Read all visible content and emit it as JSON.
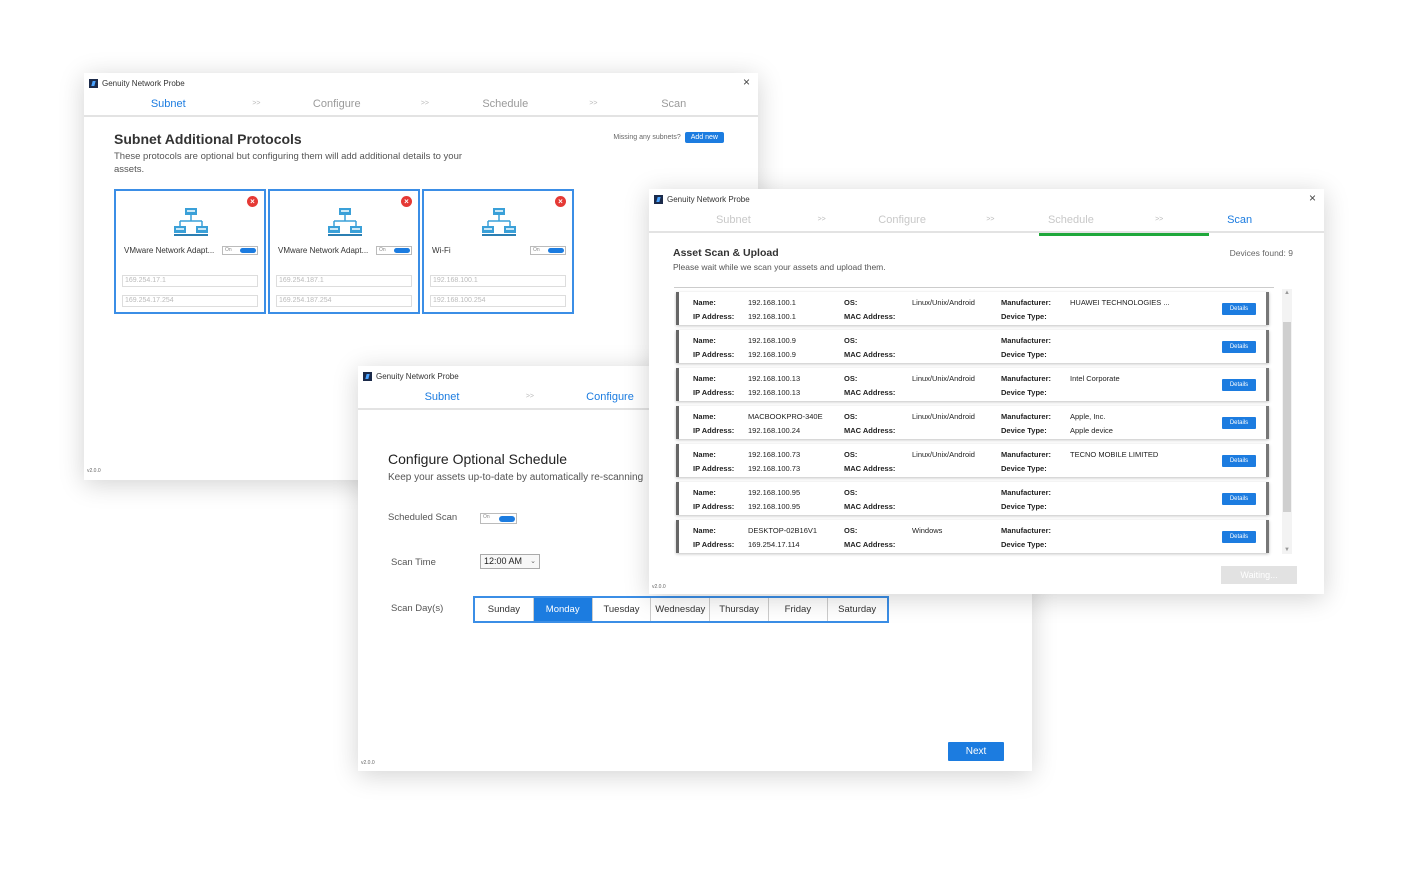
{
  "app_title": "Genuity Network Probe",
  "version": "v2.0.0",
  "close_glyph": "×",
  "step_separator": ">>",
  "w1": {
    "steps": [
      "Subnet",
      "Configure",
      "Schedule",
      "Scan"
    ],
    "title": "Subnet Additional Protocols",
    "description": "These protocols are optional but configuring them will add additional details to your assets.",
    "missing_label": "Missing any subnets?",
    "add_new": "Add new",
    "cards": [
      {
        "name": "VMware Network Adapt...",
        "ip_start": "169.254.17.1",
        "ip_end": "169.254.17.254",
        "toggle": "On"
      },
      {
        "name": "VMware Network Adapt...",
        "ip_start": "169.254.187.1",
        "ip_end": "169.254.187.254",
        "toggle": "On"
      },
      {
        "name": "Wi-Fi",
        "ip_start": "192.168.100.1",
        "ip_end": "192.168.100.254",
        "toggle": "On"
      }
    ]
  },
  "w2": {
    "steps": [
      "Subnet",
      "Configure"
    ],
    "title": "Configure Optional Schedule",
    "description": "Keep your assets up-to-date by automatically re-scanning",
    "scheduled_scan_label": "Scheduled Scan",
    "toggle": "On",
    "scan_time_label": "Scan Time",
    "scan_time_value": "12:00 AM",
    "scan_days_label": "Scan Day(s)",
    "days": [
      "Sunday",
      "Monday",
      "Tuesday",
      "Wednesday",
      "Thursday",
      "Friday",
      "Saturday"
    ],
    "selected_day": "Monday",
    "next": "Next"
  },
  "w3": {
    "steps": [
      "Subnet",
      "Configure",
      "Schedule",
      "Scan"
    ],
    "title": "Asset Scan & Upload",
    "description": "Please wait while we scan your assets and upload them.",
    "devices_found": "Devices found: 9",
    "labels": {
      "name": "Name:",
      "ip": "IP Address:",
      "os": "OS:",
      "mac": "MAC Address:",
      "manufacturer": "Manufacturer:",
      "device_type": "Device Type:"
    },
    "details": "Details",
    "waiting": "Waiting...",
    "rows": [
      {
        "name": "192.168.100.1",
        "ip": "192.168.100.1",
        "os": "Linux/Unix/Android",
        "mac": "",
        "manufacturer": "HUAWEI TECHNOLOGIES ...",
        "device_type": ""
      },
      {
        "name": "192.168.100.9",
        "ip": "192.168.100.9",
        "os": "",
        "mac": "",
        "manufacturer": "",
        "device_type": ""
      },
      {
        "name": "192.168.100.13",
        "ip": "192.168.100.13",
        "os": "Linux/Unix/Android",
        "mac": "",
        "manufacturer": "Intel Corporate",
        "device_type": ""
      },
      {
        "name": "MACBOOKPRO-340E",
        "ip": "192.168.100.24",
        "os": "Linux/Unix/Android",
        "mac": "",
        "manufacturer": "Apple, Inc.",
        "device_type": "Apple device"
      },
      {
        "name": "192.168.100.73",
        "ip": "192.168.100.73",
        "os": "Linux/Unix/Android",
        "mac": "",
        "manufacturer": "TECNO MOBILE LIMITED",
        "device_type": ""
      },
      {
        "name": "192.168.100.95",
        "ip": "192.168.100.95",
        "os": "",
        "mac": "",
        "manufacturer": "",
        "device_type": ""
      },
      {
        "name": "DESKTOP-02B16V1",
        "ip": "169.254.17.114",
        "os": "Windows",
        "mac": "",
        "manufacturer": "",
        "device_type": ""
      }
    ]
  }
}
